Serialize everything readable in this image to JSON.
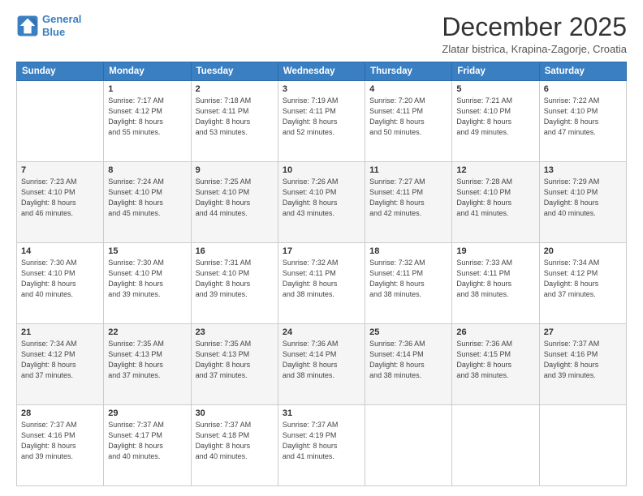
{
  "header": {
    "logo_line1": "General",
    "logo_line2": "Blue",
    "title": "December 2025",
    "subtitle": "Zlatar bistrica, Krapina-Zagorje, Croatia"
  },
  "days_of_week": [
    "Sunday",
    "Monday",
    "Tuesday",
    "Wednesday",
    "Thursday",
    "Friday",
    "Saturday"
  ],
  "weeks": [
    [
      {
        "day": "",
        "info": ""
      },
      {
        "day": "1",
        "info": "Sunrise: 7:17 AM\nSunset: 4:12 PM\nDaylight: 8 hours\nand 55 minutes."
      },
      {
        "day": "2",
        "info": "Sunrise: 7:18 AM\nSunset: 4:11 PM\nDaylight: 8 hours\nand 53 minutes."
      },
      {
        "day": "3",
        "info": "Sunrise: 7:19 AM\nSunset: 4:11 PM\nDaylight: 8 hours\nand 52 minutes."
      },
      {
        "day": "4",
        "info": "Sunrise: 7:20 AM\nSunset: 4:11 PM\nDaylight: 8 hours\nand 50 minutes."
      },
      {
        "day": "5",
        "info": "Sunrise: 7:21 AM\nSunset: 4:10 PM\nDaylight: 8 hours\nand 49 minutes."
      },
      {
        "day": "6",
        "info": "Sunrise: 7:22 AM\nSunset: 4:10 PM\nDaylight: 8 hours\nand 47 minutes."
      }
    ],
    [
      {
        "day": "7",
        "info": "Sunrise: 7:23 AM\nSunset: 4:10 PM\nDaylight: 8 hours\nand 46 minutes."
      },
      {
        "day": "8",
        "info": "Sunrise: 7:24 AM\nSunset: 4:10 PM\nDaylight: 8 hours\nand 45 minutes."
      },
      {
        "day": "9",
        "info": "Sunrise: 7:25 AM\nSunset: 4:10 PM\nDaylight: 8 hours\nand 44 minutes."
      },
      {
        "day": "10",
        "info": "Sunrise: 7:26 AM\nSunset: 4:10 PM\nDaylight: 8 hours\nand 43 minutes."
      },
      {
        "day": "11",
        "info": "Sunrise: 7:27 AM\nSunset: 4:11 PM\nDaylight: 8 hours\nand 42 minutes."
      },
      {
        "day": "12",
        "info": "Sunrise: 7:28 AM\nSunset: 4:10 PM\nDaylight: 8 hours\nand 41 minutes."
      },
      {
        "day": "13",
        "info": "Sunrise: 7:29 AM\nSunset: 4:10 PM\nDaylight: 8 hours\nand 40 minutes."
      }
    ],
    [
      {
        "day": "14",
        "info": "Sunrise: 7:30 AM\nSunset: 4:10 PM\nDaylight: 8 hours\nand 40 minutes."
      },
      {
        "day": "15",
        "info": "Sunrise: 7:30 AM\nSunset: 4:10 PM\nDaylight: 8 hours\nand 39 minutes."
      },
      {
        "day": "16",
        "info": "Sunrise: 7:31 AM\nSunset: 4:10 PM\nDaylight: 8 hours\nand 39 minutes."
      },
      {
        "day": "17",
        "info": "Sunrise: 7:32 AM\nSunset: 4:11 PM\nDaylight: 8 hours\nand 38 minutes."
      },
      {
        "day": "18",
        "info": "Sunrise: 7:32 AM\nSunset: 4:11 PM\nDaylight: 8 hours\nand 38 minutes."
      },
      {
        "day": "19",
        "info": "Sunrise: 7:33 AM\nSunset: 4:11 PM\nDaylight: 8 hours\nand 38 minutes."
      },
      {
        "day": "20",
        "info": "Sunrise: 7:34 AM\nSunset: 4:12 PM\nDaylight: 8 hours\nand 37 minutes."
      }
    ],
    [
      {
        "day": "21",
        "info": "Sunrise: 7:34 AM\nSunset: 4:12 PM\nDaylight: 8 hours\nand 37 minutes."
      },
      {
        "day": "22",
        "info": "Sunrise: 7:35 AM\nSunset: 4:13 PM\nDaylight: 8 hours\nand 37 minutes."
      },
      {
        "day": "23",
        "info": "Sunrise: 7:35 AM\nSunset: 4:13 PM\nDaylight: 8 hours\nand 37 minutes."
      },
      {
        "day": "24",
        "info": "Sunrise: 7:36 AM\nSunset: 4:14 PM\nDaylight: 8 hours\nand 38 minutes."
      },
      {
        "day": "25",
        "info": "Sunrise: 7:36 AM\nSunset: 4:14 PM\nDaylight: 8 hours\nand 38 minutes."
      },
      {
        "day": "26",
        "info": "Sunrise: 7:36 AM\nSunset: 4:15 PM\nDaylight: 8 hours\nand 38 minutes."
      },
      {
        "day": "27",
        "info": "Sunrise: 7:37 AM\nSunset: 4:16 PM\nDaylight: 8 hours\nand 39 minutes."
      }
    ],
    [
      {
        "day": "28",
        "info": "Sunrise: 7:37 AM\nSunset: 4:16 PM\nDaylight: 8 hours\nand 39 minutes."
      },
      {
        "day": "29",
        "info": "Sunrise: 7:37 AM\nSunset: 4:17 PM\nDaylight: 8 hours\nand 40 minutes."
      },
      {
        "day": "30",
        "info": "Sunrise: 7:37 AM\nSunset: 4:18 PM\nDaylight: 8 hours\nand 40 minutes."
      },
      {
        "day": "31",
        "info": "Sunrise: 7:37 AM\nSunset: 4:19 PM\nDaylight: 8 hours\nand 41 minutes."
      },
      {
        "day": "",
        "info": ""
      },
      {
        "day": "",
        "info": ""
      },
      {
        "day": "",
        "info": ""
      }
    ]
  ]
}
